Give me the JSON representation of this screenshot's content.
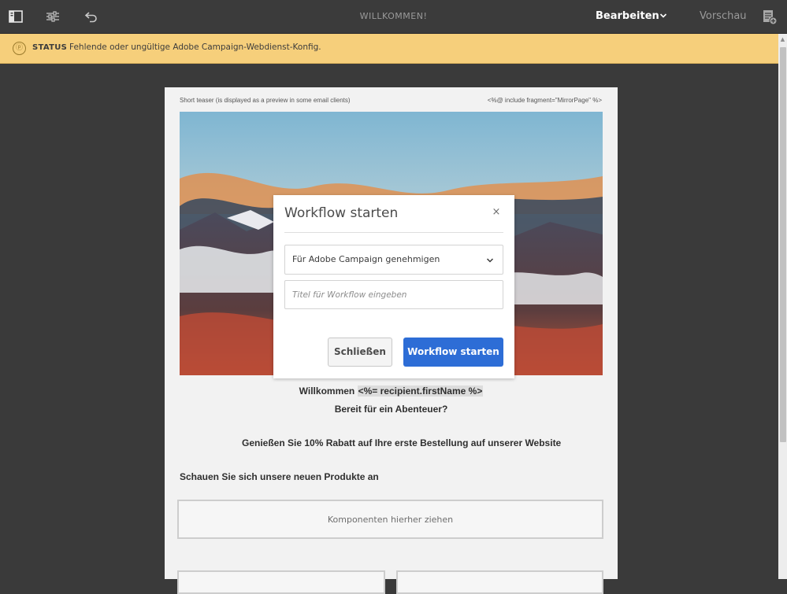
{
  "toolbar": {
    "title": "WILLKOMMEN!",
    "mode_label": "Bearbeiten",
    "preview_label": "Vorschau",
    "icons": [
      "side-panel-icon",
      "properties-sliders-icon",
      "undo-icon",
      "chevron-down-icon",
      "annotations-icon"
    ]
  },
  "status": {
    "label": "STATUS",
    "message": "Fehlende oder ungültige Adobe Campaign-Webdienst-Konfig.",
    "color": "#f6cf7b"
  },
  "email": {
    "preheader": "Short teaser (is displayed as a preview in some email clients)",
    "mirror_page": "<%@ include fragment=\"MirrorPage\" %>",
    "welcome_prefix": "Willkommen",
    "welcome_tag": "<%= recipient.firstName %>",
    "subline": "Bereit für ein Abenteuer?",
    "discount": "Genießen Sie 10% Rabatt auf Ihre erste Bestellung auf unserer Website",
    "products_heading": "Schauen Sie sich unsere neuen Produkte an",
    "dropzone_label": "Komponenten hierher ziehen"
  },
  "dialog": {
    "title": "Workflow starten",
    "close_glyph": "×",
    "workflow_select": "Für Adobe Campaign genehmigen",
    "title_placeholder": "Titel für Workflow eingeben",
    "cancel_label": "Schließen",
    "confirm_label": "Workflow starten",
    "accent_color": "#2d6dd6"
  }
}
